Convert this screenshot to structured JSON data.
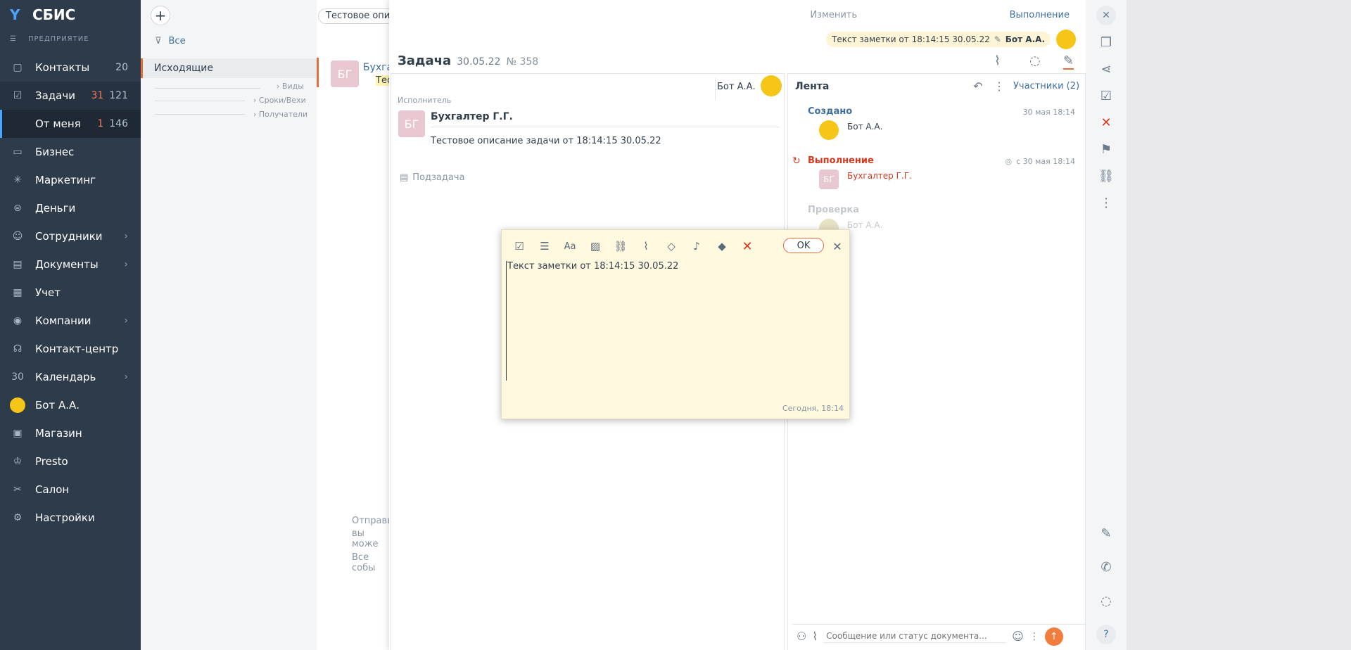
{
  "brand": {
    "name": "СБИС",
    "subtitle": "ПРЕДПРИЯТИЕ"
  },
  "nav": [
    {
      "label": "Контакты",
      "count": "20",
      "icon": "chat-icon"
    },
    {
      "label": "Задачи",
      "count_red": "31",
      "count": "121",
      "icon": "tasks-icon"
    },
    {
      "label": "От меня",
      "count_red": "1",
      "count": "146"
    },
    {
      "label": "Бизнес",
      "icon": "briefcase-icon"
    },
    {
      "label": "Маркетинг",
      "icon": "star-icon"
    },
    {
      "label": "Деньги",
      "icon": "money-icon"
    },
    {
      "label": "Сотрудники",
      "icon": "people-icon"
    },
    {
      "label": "Документы",
      "icon": "documents-icon"
    },
    {
      "label": "Учет",
      "icon": "calculator-icon"
    },
    {
      "label": "Компании",
      "icon": "map-pin-icon"
    },
    {
      "label": "Контакт-центр",
      "icon": "headset-icon"
    },
    {
      "label": "Календарь",
      "icon": "calendar-icon",
      "icon_text": "30"
    },
    {
      "label": "Бот А.А.",
      "icon": "bot-avatar-icon"
    },
    {
      "label": "Магазин",
      "icon": "cart-icon"
    },
    {
      "label": "Presto",
      "icon": "chef-icon"
    },
    {
      "label": "Салон",
      "icon": "salon-icon"
    },
    {
      "label": "Настройки",
      "icon": "gear-icon"
    }
  ],
  "filter": {
    "all": "Все",
    "outgoing": "Исходящие",
    "types": "Виды",
    "deadlines": "Сроки/Вехи",
    "recipients": "Получатели"
  },
  "list": {
    "search_chip": "Тестовое описа",
    "item_avatar": "БГ",
    "item_name": "Бухга",
    "item_desc": "Тес",
    "hint1": "Отправь",
    "hint2": "вы може",
    "hint3": "Все собы"
  },
  "task": {
    "top_links": {
      "edit": "Изменить",
      "status": "Выполнение"
    },
    "note_chip": "Текст заметки от 18:14:15 30.05.22",
    "note_author": "Бот А.А.",
    "title": "Задача",
    "date": "30.05.22",
    "number": "№ 358",
    "author": "Бот А.А.",
    "executor_label": "Исполнитель",
    "executor_avatar": "БГ",
    "executor_name": "Бухгалтер Г.Г.",
    "description": "Тестовое описание задачи от 18:14:15 30.05.22",
    "subtask": "Подзадача"
  },
  "feed": {
    "title": "Лента",
    "participants": "Участники (2)",
    "events": [
      {
        "title": "Создано",
        "time": "30 мая 18:14",
        "who": "Бот А.А."
      },
      {
        "title": "Выполнение",
        "time": "с 30 мая 18:14",
        "who": "Бухгалтер Г.Г.",
        "avatar": "БГ"
      },
      {
        "title": "Проверка",
        "who": "Бот А.А."
      }
    ],
    "input_placeholder": "Сообщение или статус документа..."
  },
  "note": {
    "text": "Текст заметки от 18:14:15 30.05.22",
    "ok": "OK",
    "timestamp": "Сегодня, 18:14"
  }
}
